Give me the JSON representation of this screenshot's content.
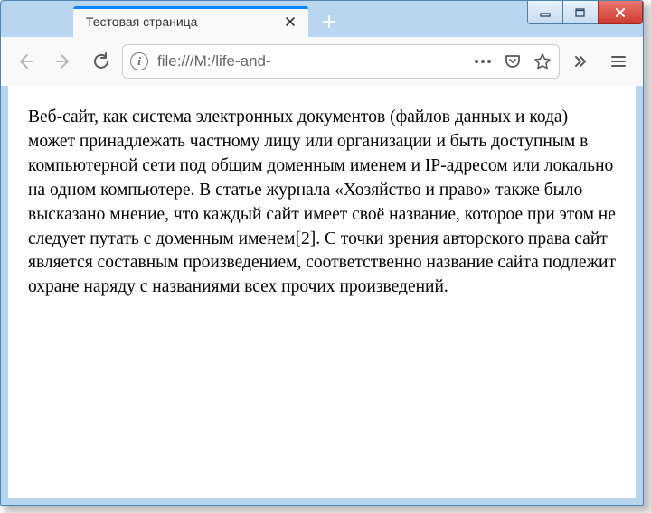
{
  "tab": {
    "title": "Тестовая страница"
  },
  "url": "file:///M:/life-and-",
  "page": {
    "body": "Веб-сайт, как система электронных документов (файлов данных и кода) может принадлежать частному лицу или организации и быть доступным в компьютерной сети под общим доменным именем и IP-адресом или локально на одном компьютере. В статье журнала «Хозяйство и право» также было высказано мнение, что каждый сайт имеет своё название, которое при этом не следует путать с доменным именем[2]. С точки зрения авторского права сайт является составным произведением, соответственно название сайта подлежит охране наряду с названиями всех прочих произведений."
  }
}
